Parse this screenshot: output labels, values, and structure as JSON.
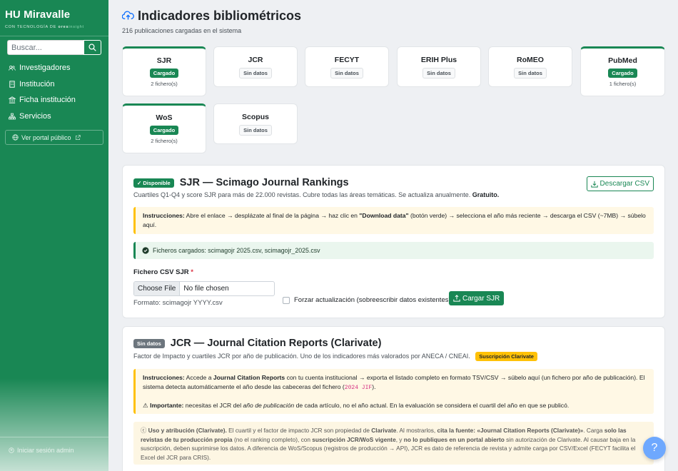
{
  "sidebar": {
    "brand_title": "HU Miravalle",
    "brand_sub_prefix": "CON TECNOLOGÍA DE",
    "brand_sub_ores": "ores",
    "brand_sub_insight": "insight",
    "search_placeholder": "Buscar...",
    "items": [
      {
        "label": "Investigadores",
        "icon": "users-icon"
      },
      {
        "label": "Institución",
        "icon": "building-icon"
      },
      {
        "label": "Ficha institución",
        "icon": "bank-icon"
      },
      {
        "label": "Servicios",
        "icon": "sitemap-icon"
      }
    ],
    "portal_label": "Ver portal público",
    "login_label": "Iniciar sesión admin"
  },
  "header": {
    "title": "Indicadores bibliométricos",
    "subtitle": "216 publicaciones cargadas en el sistema"
  },
  "sources": [
    {
      "name": "SJR",
      "status": "Cargado",
      "files": "2 fichero(s)"
    },
    {
      "name": "JCR",
      "status": "Sin datos",
      "files": ""
    },
    {
      "name": "FECYT",
      "status": "Sin datos",
      "files": ""
    },
    {
      "name": "ERIH Plus",
      "status": "Sin datos",
      "files": ""
    },
    {
      "name": "RoMEO",
      "status": "Sin datos",
      "files": ""
    },
    {
      "name": "PubMed",
      "status": "Cargado",
      "files": "1 fichero(s)"
    },
    {
      "name": "WoS",
      "status": "Cargado",
      "files": "2 fichero(s)"
    },
    {
      "name": "Scopus",
      "status": "Sin datos",
      "files": ""
    }
  ],
  "sjr": {
    "badge": "✓ Disponible",
    "title": "SJR — Scimago Journal Rankings",
    "desc": "Cuartiles Q1-Q4 y score SJR para más de 22.000 revistas. Cubre todas las áreas temáticas. Se actualiza anualmente.",
    "desc_bold": "Gratuito.",
    "download_label": "Descargar CSV",
    "instr_label": "Instrucciones:",
    "instr_a": "Abre el enlace → desplázate al final de la página → haz clic en",
    "instr_bold": "\"Download data\"",
    "instr_b": "(botón verde) → selecciona el año más reciente → descarga el CSV (~7MB) → súbelo aquí.",
    "loaded_files": "Ficheros cargados: scimagojr 2025.csv, scimagojr_2025.csv",
    "field_label": "Fichero CSV SJR",
    "required_mark": "*",
    "choose_label": "Choose File",
    "no_file": "No file chosen",
    "format": "Formato: scimagojr YYYY.csv",
    "force_label": "Forzar actualización (sobreescribir datos existentes)",
    "upload_label": "Cargar SJR"
  },
  "jcr": {
    "badge": "Sin datos",
    "title": "JCR — Journal Citation Reports (Clarivate)",
    "desc": "Factor de Impacto y cuartiles JCR por año de publicación. Uno de los indicadores más valorados por ANECA / CNEAI.",
    "sub_badge": "Suscripción Clarivate",
    "instr_label": "Instrucciones:",
    "instr_a": "Accede a",
    "instr_bold": "Journal Citation Reports",
    "instr_b": "con tu cuenta institucional → exporta el listado completo en formato TSV/CSV → súbelo aquí (un fichero por año de publicación). El sistema detecta automáticamente el año desde las cabeceras del fichero (",
    "instr_code": "2024 JIF",
    "instr_c": ").",
    "important_label": "Importante:",
    "important_a": "necesitas el JCR del",
    "important_em": "año de publicación",
    "important_b": "de cada artículo, no el año actual. En la evaluación se considera el cuartil del año en que se publicó.",
    "usage_label": "Uso y atribución (Clarivate).",
    "usage_a": "El cuartil y el factor de impacto JCR son propiedad de",
    "usage_b1": "Clarivate",
    "usage_c": ". Al mostrarlos,",
    "usage_b2": "cita la fuente: «Journal Citation Reports (Clarivate)»",
    "usage_d": ". Carga",
    "usage_b3": "solo las revistas de tu producción propia",
    "usage_e": "(no el ranking completo), con",
    "usage_b4": "suscripción JCR/WoS vigente",
    "usage_f": ", y",
    "usage_b5": "no lo publiques en un portal abierto",
    "usage_g": "sin autorización de Clarivate. Al causar baja en la suscripción, deben suprimirse los datos. A diferencia de WoS/Scopus (registros de producción → API), JCR es dato de referencia de revista y admite carga por CSV/Excel (FECYT facilita el Excel del JCR para CRIS)."
  },
  "help_label": "?",
  "colors": {
    "brand": "#198754",
    "warning": "#ffc107",
    "fab": "#6ea8fe"
  }
}
